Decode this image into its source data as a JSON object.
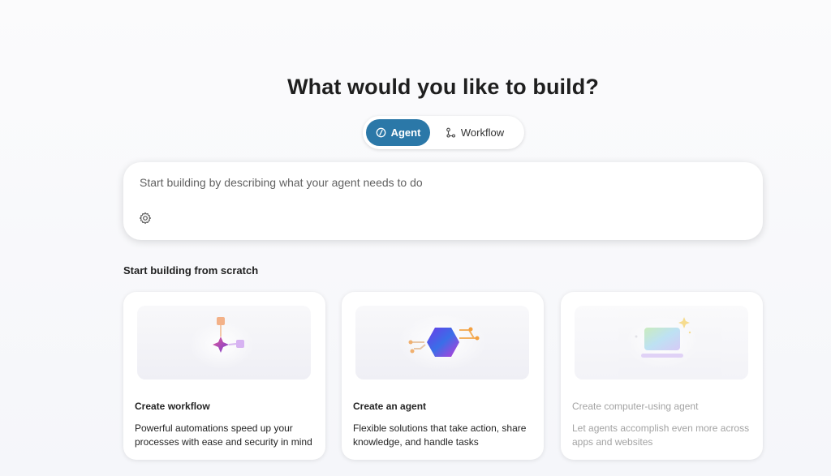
{
  "heading": "What would you like to build?",
  "mode_toggle": {
    "agent_label": "Agent",
    "workflow_label": "Workflow",
    "selected": "Agent"
  },
  "prompt": {
    "placeholder": "Start building by describing what your agent needs to do",
    "value": "",
    "settings_icon": "gear-icon",
    "send_icon": "send-icon"
  },
  "section_title": "Start building from scratch",
  "cards": [
    {
      "title": "Create workflow",
      "description": "Powerful automations speed up your processes with ease and security in mind",
      "icon": "workflow-illustration",
      "enabled": true
    },
    {
      "title": "Create an agent",
      "description": "Flexible solutions that take action, share knowledge, and handle tasks",
      "icon": "agent-illustration",
      "enabled": true
    },
    {
      "title": "Create computer-using agent",
      "description": "Let agents accomplish even more across apps and websites",
      "icon": "computer-illustration",
      "enabled": false
    }
  ],
  "colors": {
    "accent": "#2b78a8",
    "background": "#f7f8fb",
    "card": "#ffffff"
  }
}
